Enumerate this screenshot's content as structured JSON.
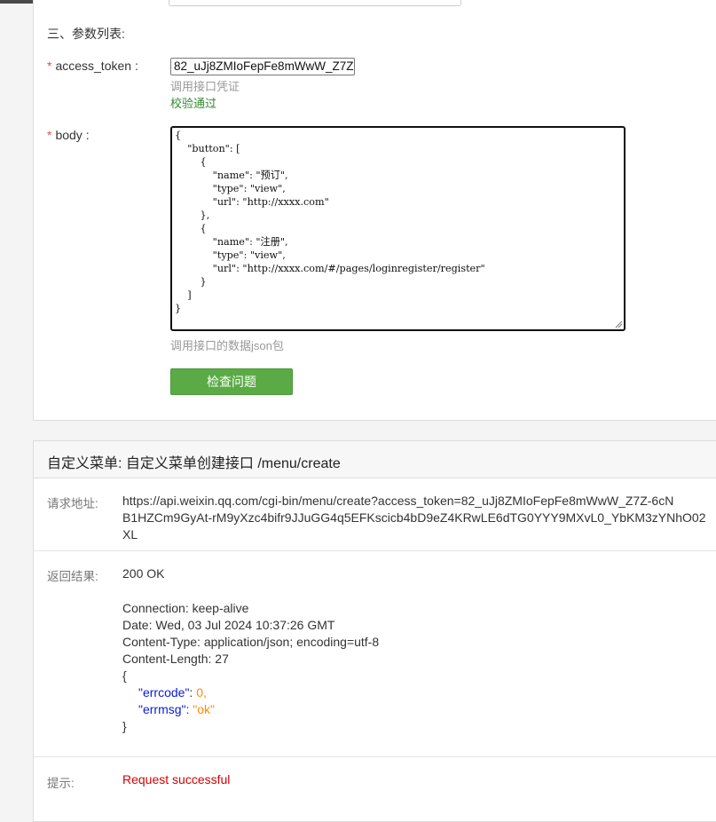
{
  "params": {
    "section_title": "三、参数列表:",
    "access_token": {
      "label": "access_token :",
      "value": "82_uJj8ZMIoFepFe8mWwW_Z7Z",
      "hint": "调用接口凭证",
      "status": "校验通过"
    },
    "body": {
      "label": "body :",
      "value": "{\n    \"button\": [\n        {\n            \"name\": \"预订\",\n            \"type\": \"view\",\n            \"url\": \"http://xxxx.com\"\n        },\n        {\n            \"name\": \"注册\",\n            \"type\": \"view\",\n            \"url\": \"http://xxxx.com/#/pages/loginregister/register\"\n        }\n    ]\n}",
      "hint": "调用接口的数据json包"
    },
    "check_button": "检查问题"
  },
  "result": {
    "title": "自定义菜单: 自定义菜单创建接口 /menu/create",
    "request_url_label": "请求地址:",
    "request_url": "https://api.weixin.qq.com/cgi-bin/menu/create?access_token=82_uJj8ZMIoFepFe8mWwW_Z7Z-6cN\nB1HZCm9GyAt-rM9yXzc4bifr9JJuGG4q5EFKscicb4bD9eZ4KRwLE6dTG0YYY9MXvL0_YbKM3zYNhO02\nXL",
    "response_label": "返回结果:",
    "status_line": "200 OK",
    "headers": [
      "Connection: keep-alive",
      "Date: Wed, 03 Jul 2024 10:37:26 GMT",
      "Content-Type: application/json; encoding=utf-8",
      "Content-Length: 27"
    ],
    "json_open": "{",
    "json_close": "}",
    "errcode_key": "\"errcode\"",
    "errcode_value": "0,",
    "errmsg_key": "\"errmsg\"",
    "errmsg_value": "\"ok\"",
    "colon": ": ",
    "tip_label": "提示:",
    "tip_value": "Request successful"
  },
  "colors": {
    "button_green": "#5aab45",
    "success_green": "#2e8b2e",
    "json_key_blue": "#0b1ad6",
    "json_value_orange": "#ff8a00",
    "tip_red": "#d40000",
    "required_red": "#d9534f"
  }
}
